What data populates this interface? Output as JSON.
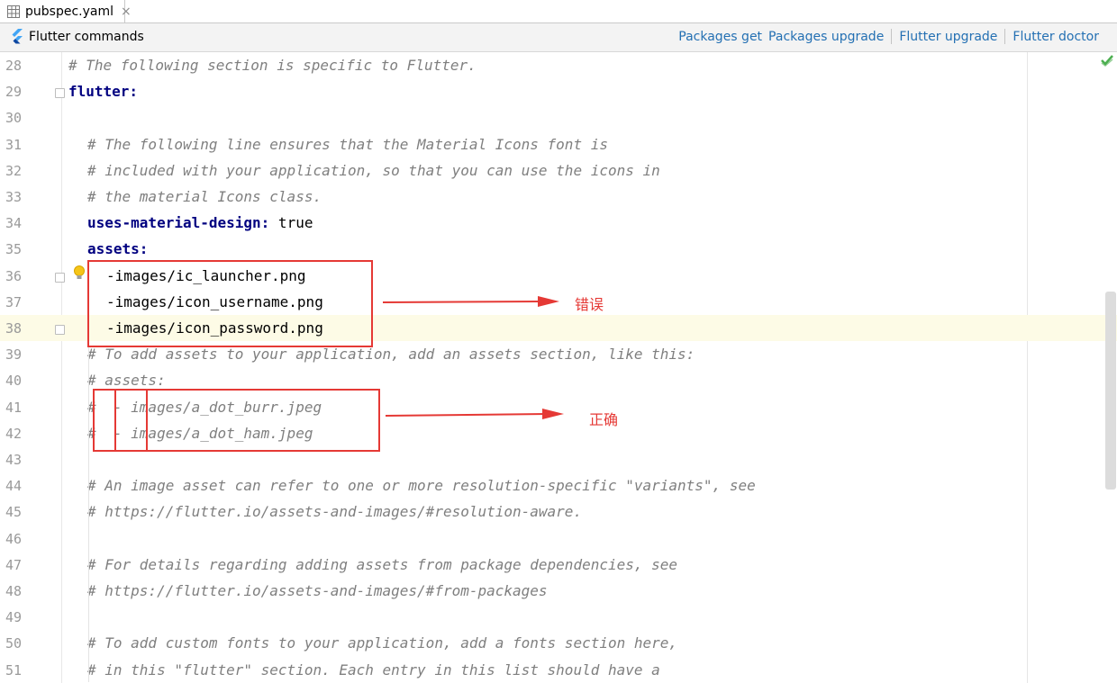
{
  "tab": {
    "filename": "pubspec.yaml",
    "close": "×"
  },
  "commands": {
    "title": "Flutter commands",
    "actions": [
      "Packages get",
      "Packages upgrade",
      "Flutter upgrade",
      "Flutter doctor"
    ]
  },
  "editor": {
    "current_line": 38,
    "lines": [
      {
        "n": "28",
        "parts": [
          {
            "c": "cmt",
            "t": "# The following section is specific to Flutter."
          }
        ],
        "indent": 0
      },
      {
        "n": "29",
        "parts": [
          {
            "c": "key",
            "t": "flutter:"
          }
        ],
        "indent": 0
      },
      {
        "n": "30",
        "parts": [],
        "indent": 0
      },
      {
        "n": "31",
        "parts": [
          {
            "c": "cmt",
            "t": "# The following line ensures that the Material Icons font is"
          }
        ],
        "indent": 1
      },
      {
        "n": "32",
        "parts": [
          {
            "c": "cmt",
            "t": "# included with your application, so that you can use the icons in"
          }
        ],
        "indent": 1
      },
      {
        "n": "33",
        "parts": [
          {
            "c": "cmt",
            "t": "# the material Icons class."
          }
        ],
        "indent": 1
      },
      {
        "n": "34",
        "parts": [
          {
            "c": "key",
            "t": "uses-material-design:"
          },
          {
            "c": "val",
            "t": " true"
          }
        ],
        "indent": 1
      },
      {
        "n": "35",
        "parts": [
          {
            "c": "key",
            "t": "assets:"
          }
        ],
        "indent": 1
      },
      {
        "n": "36",
        "parts": [
          {
            "c": "val",
            "t": "-images/ic_launcher.png"
          }
        ],
        "indent": 2
      },
      {
        "n": "37",
        "parts": [
          {
            "c": "val",
            "t": "-images/icon_username.png"
          }
        ],
        "indent": 2
      },
      {
        "n": "38",
        "parts": [
          {
            "c": "val",
            "t": "-images/icon_password.png"
          }
        ],
        "indent": 2
      },
      {
        "n": "39",
        "parts": [
          {
            "c": "cmt",
            "t": "# To add assets to your application, add an assets section, like this:"
          }
        ],
        "indent": 1
      },
      {
        "n": "40",
        "parts": [
          {
            "c": "cmt",
            "t": "# assets:"
          }
        ],
        "indent": 1
      },
      {
        "n": "41",
        "parts": [
          {
            "c": "cmt",
            "t": "#  - images/a_dot_burr.jpeg"
          }
        ],
        "indent": 1
      },
      {
        "n": "42",
        "parts": [
          {
            "c": "cmt",
            "t": "#  - images/a_dot_ham.jpeg"
          }
        ],
        "indent": 1
      },
      {
        "n": "43",
        "parts": [],
        "indent": 0
      },
      {
        "n": "44",
        "parts": [
          {
            "c": "cmt",
            "t": "# An image asset can refer to one or more resolution-specific \"variants\", see"
          }
        ],
        "indent": 1
      },
      {
        "n": "45",
        "parts": [
          {
            "c": "cmt",
            "t": "# https://flutter.io/assets-and-images/#resolution-aware."
          }
        ],
        "indent": 1
      },
      {
        "n": "46",
        "parts": [],
        "indent": 0
      },
      {
        "n": "47",
        "parts": [
          {
            "c": "cmt",
            "t": "# For details regarding adding assets from package dependencies, see"
          }
        ],
        "indent": 1
      },
      {
        "n": "48",
        "parts": [
          {
            "c": "cmt",
            "t": "# https://flutter.io/assets-and-images/#from-packages"
          }
        ],
        "indent": 1
      },
      {
        "n": "49",
        "parts": [],
        "indent": 0
      },
      {
        "n": "50",
        "parts": [
          {
            "c": "cmt",
            "t": "# To add custom fonts to your application, add a fonts section here,"
          }
        ],
        "indent": 1
      },
      {
        "n": "51",
        "parts": [
          {
            "c": "cmt",
            "t": "# in this \"flutter\" section. Each entry in this list should have a"
          }
        ],
        "indent": 1
      }
    ]
  },
  "annotations": {
    "wrong_label": "错误",
    "right_label": "正确",
    "color": "#e53935"
  },
  "colors": {
    "comment": "#7f7f7f",
    "key": "#000080",
    "link": "#2470b3"
  },
  "icons": [
    "file-table-icon",
    "flutter-logo-icon",
    "close-icon",
    "fold-marker-icon",
    "lightbulb-icon",
    "checkmark-icon",
    "arrow-icon"
  ]
}
